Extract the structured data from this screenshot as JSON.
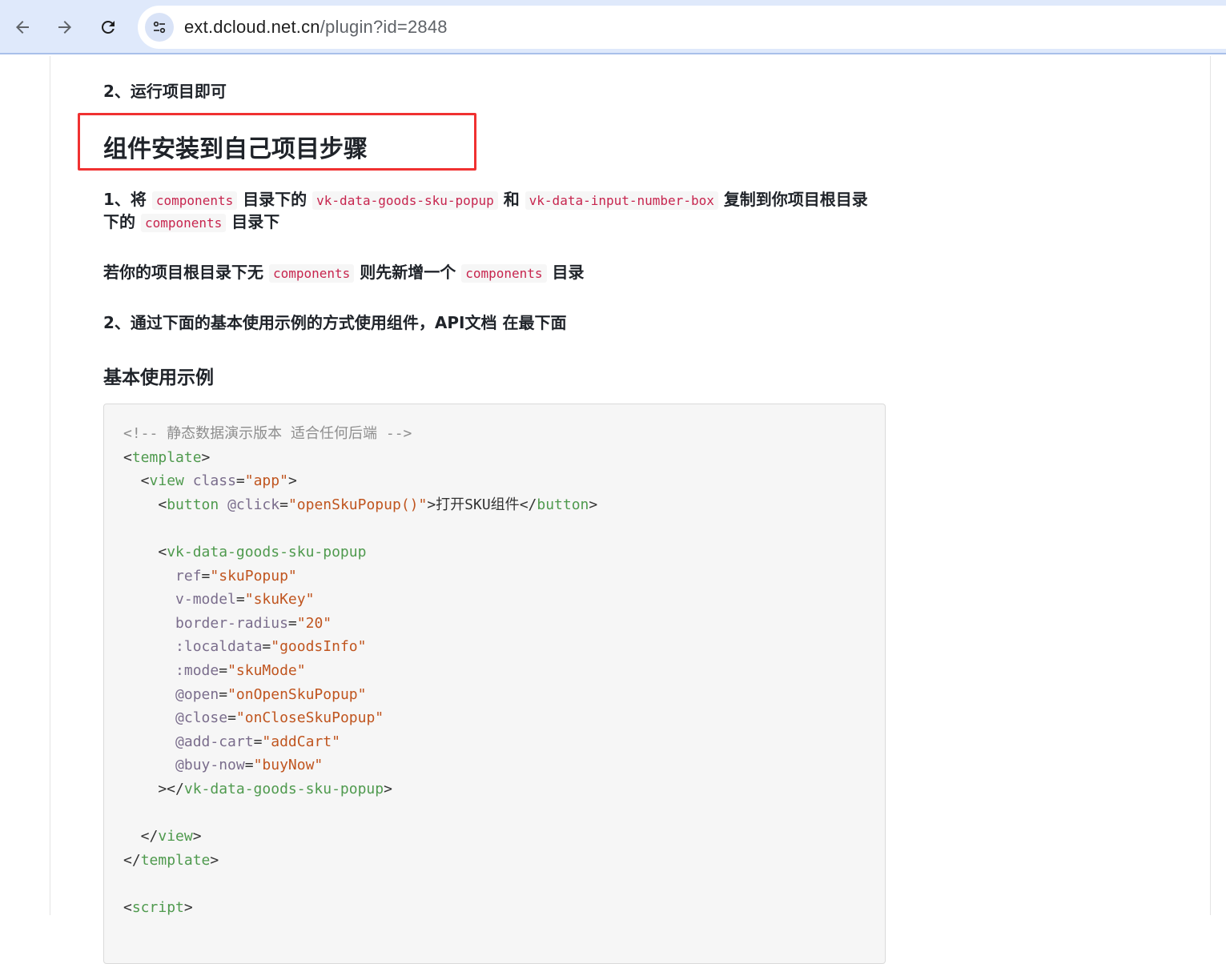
{
  "browser": {
    "back_icon": "arrow-left-icon",
    "forward_icon": "arrow-right-icon",
    "reload_icon": "reload-icon",
    "site_info_icon": "tune-icon",
    "url_host": "ext.dcloud.net.cn",
    "url_path": "/plugin?id=2848"
  },
  "doc": {
    "step_run": "2、运行项目即可",
    "section_title": "组件安装到自己项目步骤",
    "step1": {
      "prefix": "1、将",
      "code_components": "components",
      "text_dir_under": "目录下的",
      "code_popup": "vk-data-goods-sku-popup",
      "text_and": "和",
      "code_number_box": "vk-data-input-number-box",
      "text_copy": "复制到你项目根目录",
      "text_under": "下的",
      "code_components_2": "components",
      "text_dir": "目录下"
    },
    "note": {
      "prefix": "若你的项目根目录下无",
      "code_components": "components",
      "middle": "则先新增一个",
      "code_components_2": "components",
      "suffix": "目录"
    },
    "step2": "2、通过下面的基本使用示例的方式使用组件，API文档 在最下面",
    "example_title": "基本使用示例"
  },
  "code_lines": [
    [
      {
        "t": "comment",
        "v": "<!-- 静态数据演示版本 适合任何后端 -->"
      }
    ],
    [
      {
        "t": "punct",
        "v": "<"
      },
      {
        "t": "tag",
        "v": "template"
      },
      {
        "t": "punct",
        "v": ">"
      }
    ],
    [
      {
        "t": "punct",
        "v": "  <"
      },
      {
        "t": "tag",
        "v": "view"
      },
      {
        "t": "punct",
        "v": " "
      },
      {
        "t": "attr",
        "v": "class"
      },
      {
        "t": "punct",
        "v": "="
      },
      {
        "t": "str",
        "v": "\"app\""
      },
      {
        "t": "punct",
        "v": ">"
      }
    ],
    [
      {
        "t": "punct",
        "v": "    <"
      },
      {
        "t": "tag",
        "v": "button"
      },
      {
        "t": "punct",
        "v": " "
      },
      {
        "t": "attr",
        "v": "@click"
      },
      {
        "t": "punct",
        "v": "="
      },
      {
        "t": "str",
        "v": "\"openSkuPopup()\""
      },
      {
        "t": "punct",
        "v": ">"
      },
      {
        "t": "text",
        "v": "打开SKU组件"
      },
      {
        "t": "punct",
        "v": "</"
      },
      {
        "t": "tag",
        "v": "button"
      },
      {
        "t": "punct",
        "v": ">"
      }
    ],
    [],
    [
      {
        "t": "punct",
        "v": "    <"
      },
      {
        "t": "tag",
        "v": "vk-data-goods-sku-popup"
      }
    ],
    [
      {
        "t": "punct",
        "v": "      "
      },
      {
        "t": "attr",
        "v": "ref"
      },
      {
        "t": "punct",
        "v": "="
      },
      {
        "t": "str",
        "v": "\"skuPopup\""
      }
    ],
    [
      {
        "t": "punct",
        "v": "      "
      },
      {
        "t": "attr",
        "v": "v-model"
      },
      {
        "t": "punct",
        "v": "="
      },
      {
        "t": "str",
        "v": "\"skuKey\""
      }
    ],
    [
      {
        "t": "punct",
        "v": "      "
      },
      {
        "t": "attr",
        "v": "border-radius"
      },
      {
        "t": "punct",
        "v": "="
      },
      {
        "t": "str",
        "v": "\"20\""
      }
    ],
    [
      {
        "t": "punct",
        "v": "      "
      },
      {
        "t": "attr",
        "v": ":localdata"
      },
      {
        "t": "punct",
        "v": "="
      },
      {
        "t": "str",
        "v": "\"goodsInfo\""
      }
    ],
    [
      {
        "t": "punct",
        "v": "      "
      },
      {
        "t": "attr",
        "v": ":mode"
      },
      {
        "t": "punct",
        "v": "="
      },
      {
        "t": "str",
        "v": "\"skuMode\""
      }
    ],
    [
      {
        "t": "punct",
        "v": "      "
      },
      {
        "t": "attr",
        "v": "@open"
      },
      {
        "t": "punct",
        "v": "="
      },
      {
        "t": "str",
        "v": "\"onOpenSkuPopup\""
      }
    ],
    [
      {
        "t": "punct",
        "v": "      "
      },
      {
        "t": "attr",
        "v": "@close"
      },
      {
        "t": "punct",
        "v": "="
      },
      {
        "t": "str",
        "v": "\"onCloseSkuPopup\""
      }
    ],
    [
      {
        "t": "punct",
        "v": "      "
      },
      {
        "t": "attr",
        "v": "@add-cart"
      },
      {
        "t": "punct",
        "v": "="
      },
      {
        "t": "str",
        "v": "\"addCart\""
      }
    ],
    [
      {
        "t": "punct",
        "v": "      "
      },
      {
        "t": "attr",
        "v": "@buy-now"
      },
      {
        "t": "punct",
        "v": "="
      },
      {
        "t": "str",
        "v": "\"buyNow\""
      }
    ],
    [
      {
        "t": "punct",
        "v": "    ></"
      },
      {
        "t": "tag",
        "v": "vk-data-goods-sku-popup"
      },
      {
        "t": "punct",
        "v": ">"
      }
    ],
    [],
    [
      {
        "t": "punct",
        "v": "  </"
      },
      {
        "t": "tag",
        "v": "view"
      },
      {
        "t": "punct",
        "v": ">"
      }
    ],
    [
      {
        "t": "punct",
        "v": "</"
      },
      {
        "t": "tag",
        "v": "template"
      },
      {
        "t": "punct",
        "v": ">"
      }
    ],
    [],
    [
      {
        "t": "punct",
        "v": "<"
      },
      {
        "t": "tag",
        "v": "script"
      },
      {
        "t": "punct",
        "v": ">"
      }
    ]
  ],
  "colors": {
    "browser_bar": "#dfe9fb",
    "highlight_border": "#f03131",
    "inline_code": "#c7254e",
    "code_tag": "#4f9a4e",
    "code_attr": "#7a6d8c",
    "code_string": "#c0551f",
    "code_comment": "#8e8e8e"
  }
}
